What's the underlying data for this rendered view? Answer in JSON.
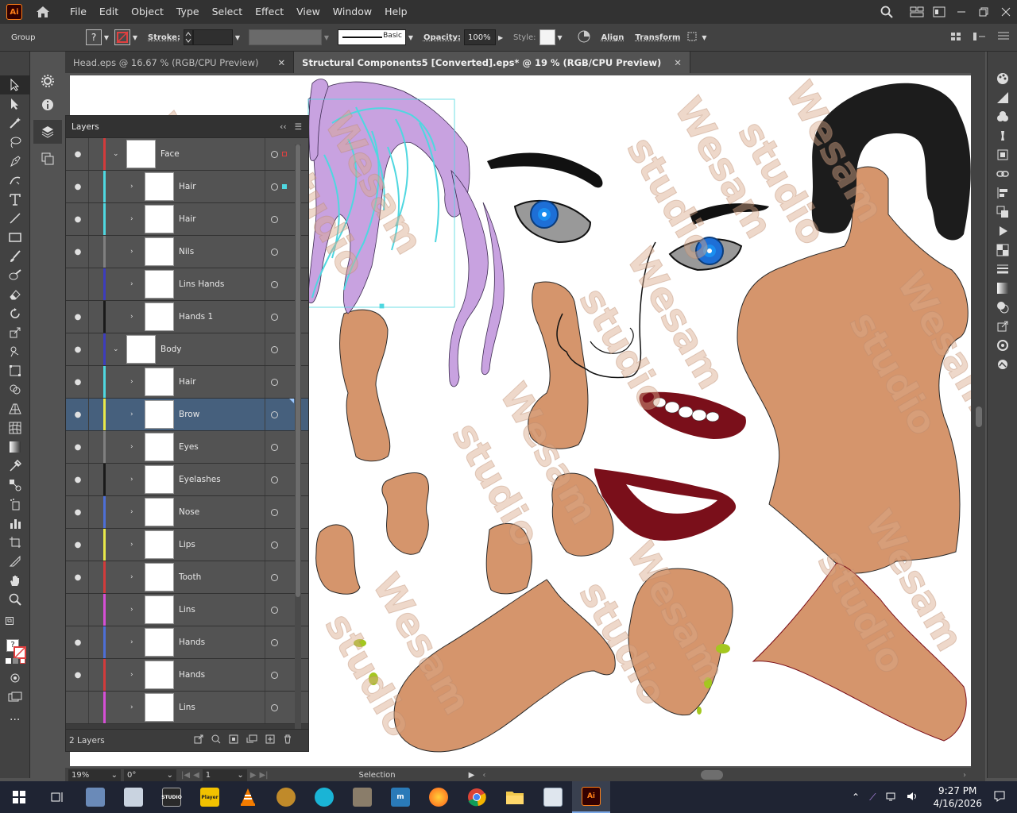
{
  "app": {
    "logo": "Ai"
  },
  "menu": [
    "File",
    "Edit",
    "Object",
    "Type",
    "Select",
    "Effect",
    "View",
    "Window",
    "Help"
  ],
  "control": {
    "selection_type": "Group",
    "fill_label": "?",
    "stroke_label": "Stroke:",
    "stroke_profile": "Basic",
    "opacity_label": "Opacity:",
    "opacity_value": "100%",
    "style_label": "Style:",
    "align_label": "Align",
    "transform_label": "Transform"
  },
  "tabs": [
    {
      "title": "Head.eps @ 16.67 % (RGB/CPU Preview)",
      "active": false
    },
    {
      "title": "Structural Components5 [Converted].eps* @ 19 % (RGB/CPU Preview)",
      "active": true
    }
  ],
  "layers_panel": {
    "title": "Layers",
    "layers": [
      {
        "name": "Face",
        "level": 0,
        "visible": true,
        "expanded": true,
        "color": "#d23b3b",
        "selected": false
      },
      {
        "name": "Hair",
        "level": 1,
        "visible": true,
        "color": "#4fd7e0",
        "selected": false
      },
      {
        "name": "Hair",
        "level": 1,
        "visible": true,
        "color": "#4fd7e0",
        "selected": false
      },
      {
        "name": "Nils",
        "level": 1,
        "visible": true,
        "color": "#808080",
        "selected": false
      },
      {
        "name": "Lins Hands",
        "level": 1,
        "visible": false,
        "color": "#3d3dbd",
        "selected": false
      },
      {
        "name": "Hands 1",
        "level": 1,
        "visible": true,
        "color": "#1a1a1a",
        "selected": false
      },
      {
        "name": "Body",
        "level": 0,
        "visible": true,
        "expanded": true,
        "color": "#3d3dbd",
        "selected": false
      },
      {
        "name": "Hair",
        "level": 1,
        "visible": true,
        "color": "#4fd7e0",
        "selected": false
      },
      {
        "name": "Brow",
        "level": 1,
        "visible": true,
        "color": "#e8e84a",
        "selected": true
      },
      {
        "name": "Eyes",
        "level": 1,
        "visible": true,
        "color": "#808080",
        "selected": false
      },
      {
        "name": "Eyelashes",
        "level": 1,
        "visible": true,
        "color": "#1a1a1a",
        "selected": false
      },
      {
        "name": "Nose",
        "level": 1,
        "visible": true,
        "color": "#4d6fd6",
        "selected": false
      },
      {
        "name": "Lips",
        "level": 1,
        "visible": true,
        "color": "#e8e84a",
        "selected": false
      },
      {
        "name": "Tooth",
        "level": 1,
        "visible": true,
        "color": "#d23b3b",
        "selected": false
      },
      {
        "name": "Lins",
        "level": 1,
        "visible": false,
        "color": "#d64fd6",
        "selected": false
      },
      {
        "name": "Hands",
        "level": 1,
        "visible": true,
        "color": "#4d6fd6",
        "selected": false
      },
      {
        "name": "Hands",
        "level": 1,
        "visible": true,
        "color": "#d23b3b",
        "selected": false
      },
      {
        "name": "Lins",
        "level": 1,
        "visible": false,
        "color": "#d64fd6",
        "selected": false
      }
    ],
    "footer_count": "2 Layers"
  },
  "status": {
    "zoom": "19%",
    "rotation": "0°",
    "artboard": "1",
    "tool": "Selection"
  },
  "watermark": "Wesam studio",
  "taskbar": {
    "time": "9:27 PM",
    "date": "4/16/2026"
  },
  "colors": {
    "skin": "#d5956c",
    "lips": "#7a0f1a",
    "hair_purple": "#c8a2e0",
    "selection": "#4fd7e0",
    "eye_blue": "#1e6fd6"
  }
}
